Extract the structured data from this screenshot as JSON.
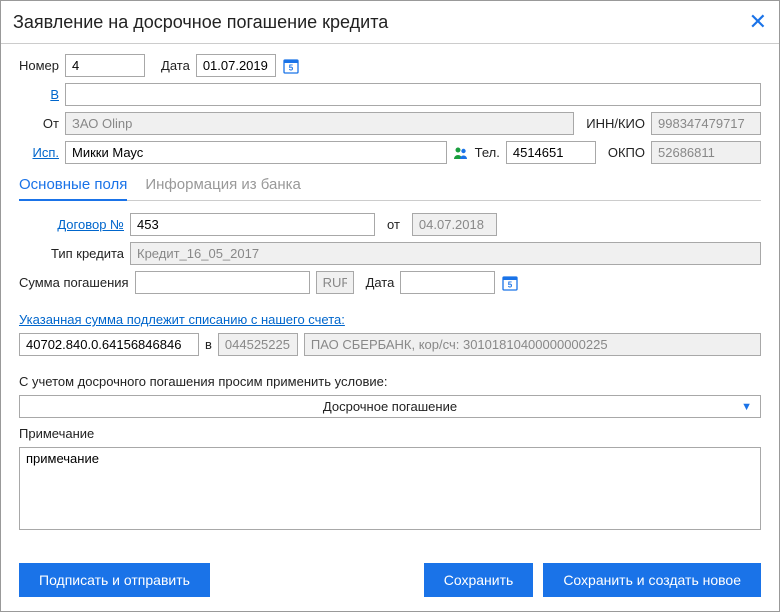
{
  "title": "Заявление на досрочное погашение кредита",
  "header": {
    "number_label": "Номер",
    "number_value": "4",
    "date_label": "Дата",
    "date_value": "01.07.2019",
    "to_label": "В",
    "to_value": "",
    "from_label": "От",
    "from_value": "ЗАО Olinp",
    "innkio_label": "ИНН/КИО",
    "innkio_value": "998347479717",
    "isp_label": "Исп.",
    "isp_value": "Микки Маус",
    "tel_label": "Тел.",
    "tel_value": "4514651",
    "okpo_label": "ОКПО",
    "okpo_value": "52686811"
  },
  "tabs": {
    "t1": "Основные поля",
    "t2": "Информация из банка"
  },
  "main": {
    "contract_label": "Договор №",
    "contract_value": "453",
    "contract_from_label": "от",
    "contract_from_value": "04.07.2018",
    "credit_type_label": "Тип кредита",
    "credit_type_value": "Кредит_16_05_2017",
    "sum_label": "Сумма погашения",
    "sum_value": "",
    "currency": "RUR",
    "sum_date_label": "Дата",
    "sum_date_value": "",
    "debit_link": "Указанная сумма подлежит списанию с нашего счета:",
    "account_value": "40702.840.0.64156846846",
    "in_label": "в",
    "bic_value": "044525225",
    "bank_value": "ПАО СБЕРБАНК, кор/сч: 30101810400000000225",
    "condition_label": "С учетом досрочного погашения просим применить условие:",
    "condition_value": "Досрочное погашение",
    "note_label": "Примечание",
    "note_value": "примечание"
  },
  "buttons": {
    "sign": "Подписать и отправить",
    "save": "Сохранить",
    "savenew": "Сохранить и создать новое"
  }
}
